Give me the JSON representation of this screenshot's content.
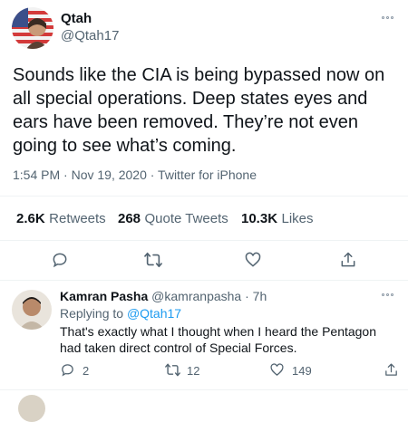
{
  "main_tweet": {
    "author_name": "Qtah",
    "author_handle": "@Qtah17",
    "text": "Sounds like the CIA is being bypassed now on all special operations. Deep states eyes and ears have been removed. They’re not even going to see what’s coming.",
    "timestamp": "1:54 PM · Nov 19, 2020 · Twitter for iPhone",
    "stats": {
      "retweets_count": "2.6K",
      "retweets_label": "Retweets",
      "quote_count": "268",
      "quote_label": "Quote Tweets",
      "likes_count": "10.3K",
      "likes_label": "Likes"
    }
  },
  "reply": {
    "author_name": "Kamran Pasha",
    "author_handle": "@kamranpasha",
    "time": "· 7h",
    "replying_prefix": "Replying to",
    "replying_to": "@Qtah17",
    "text": "That's exactly what I thought when I heard the Pentagon had taken direct control of Special Forces.",
    "reply_count": "2",
    "retweet_count": "12",
    "like_count": "149"
  },
  "colors": {
    "accent": "#1d9bf0",
    "text": "#0f1419",
    "muted": "#536471",
    "divider": "#eff3f4"
  },
  "icons": [
    "more-icon",
    "reply-icon",
    "retweet-icon",
    "like-icon",
    "share-icon"
  ]
}
